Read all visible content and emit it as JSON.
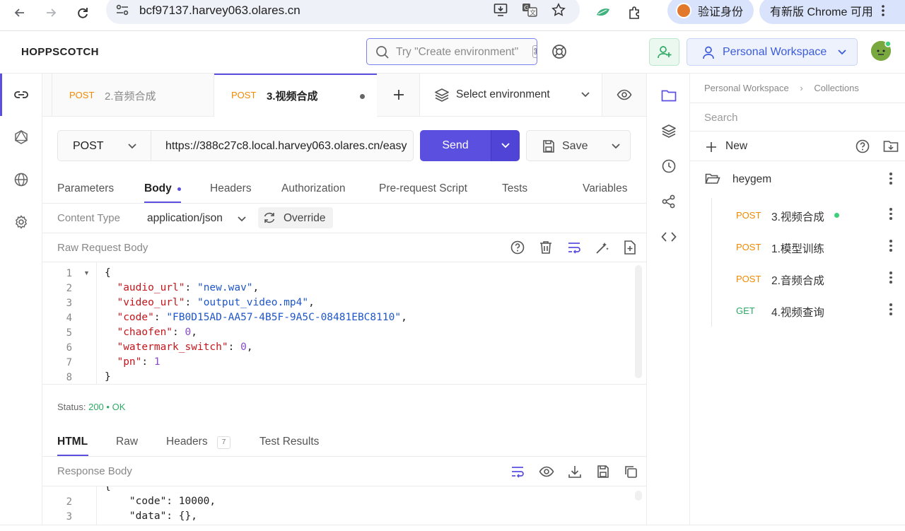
{
  "browser": {
    "url": "bcf97137.harvey063.olares.cn",
    "verify_label": "验证身份",
    "update_label": "有新版 Chrome 可用"
  },
  "app": {
    "logo": "HOPPSCOTCH",
    "search_placeholder": "Try \"Create environment\"",
    "search_shortcut": "⌘",
    "workspace_label": "Personal Workspace"
  },
  "tabs": [
    {
      "method": "POST",
      "name": "2.音频合成"
    },
    {
      "method": "POST",
      "name": "3.视频合成"
    }
  ],
  "environment": {
    "label": "Select environment"
  },
  "request": {
    "method": "POST",
    "url": "https://388c27c8.local.harvey063.olares.cn/easy",
    "send_label": "Send",
    "save_label": "Save",
    "subtabs": [
      "Parameters",
      "Body",
      "Headers",
      "Authorization",
      "Pre-request Script",
      "Tests",
      "Variables"
    ],
    "content_type_label": "Content Type",
    "content_type_value": "application/json",
    "override_label": "Override",
    "raw_body_label": "Raw Request Body",
    "body_lines": [
      {
        "num": "1",
        "text": "{"
      },
      {
        "num": "2",
        "key": "\"audio_url\"",
        "value": "\"new.wav\"",
        "type": "s",
        "trail": ","
      },
      {
        "num": "3",
        "key": "\"video_url\"",
        "value": "\"output_video.mp4\"",
        "type": "s",
        "trail": ","
      },
      {
        "num": "4",
        "key": "\"code\"",
        "value": "\"FB0D15AD-AA57-4B5F-9A5C-08481EBC8110\"",
        "type": "s",
        "trail": ","
      },
      {
        "num": "5",
        "key": "\"chaofen\"",
        "value": "0",
        "type": "n",
        "trail": ","
      },
      {
        "num": "6",
        "key": "\"watermark_switch\"",
        "value": "0",
        "type": "n",
        "trail": ","
      },
      {
        "num": "7",
        "key": "\"pn\"",
        "value": "1",
        "type": "n",
        "trail": ""
      },
      {
        "num": "8",
        "text": "}"
      }
    ]
  },
  "response": {
    "status_label": "Status:",
    "status_code": "200",
    "status_text": "OK",
    "tabs": [
      "HTML",
      "Raw",
      "Headers",
      "Test Results"
    ],
    "headers_count": "7",
    "body_label": "Response Body",
    "lines": [
      {
        "num": "2",
        "text": "    \"code\": 10000,"
      },
      {
        "num": "3",
        "text": "    \"data\": {},"
      }
    ]
  },
  "collections": {
    "breadcrumb": [
      "Personal Workspace",
      "Collections"
    ],
    "search_placeholder": "Search",
    "new_label": "New",
    "folder": "heygem",
    "items": [
      {
        "method": "POST",
        "name": "3.视频合成",
        "active": true
      },
      {
        "method": "POST",
        "name": "1.模型训练",
        "active": false
      },
      {
        "method": "POST",
        "name": "2.音频合成",
        "active": false
      },
      {
        "method": "GET",
        "name": "4.视频查询",
        "active": false
      }
    ]
  }
}
